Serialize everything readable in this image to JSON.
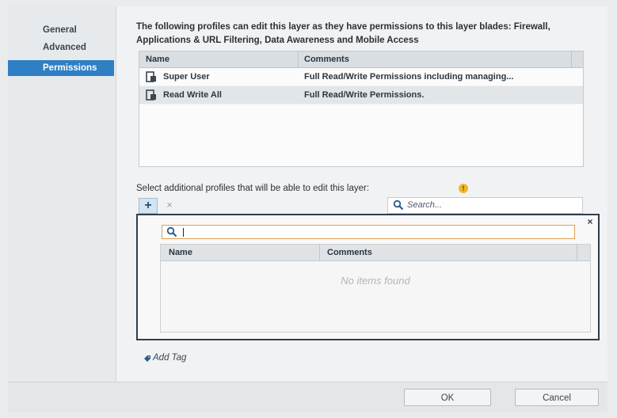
{
  "sidebar": {
    "items": [
      {
        "label": "General"
      },
      {
        "label": "Advanced"
      },
      {
        "label": "Permissions",
        "active": true
      }
    ]
  },
  "main": {
    "description": "The following profiles can edit this layer as they have permissions to this layer blades: Firewall, Applications & URL Filtering, Data Awareness and Mobile Access",
    "profiles_table": {
      "columns": [
        "Name",
        "Comments"
      ],
      "rows": [
        {
          "name": "Super User",
          "comments": "Full Read/Write Permissions including managing..."
        },
        {
          "name": "Read Write All",
          "comments": "Full Read/Write Permissions."
        }
      ]
    },
    "select_label": "Select additional profiles that will be able to edit this layer:",
    "toolbar": {
      "add_label": "+",
      "remove_label": "×",
      "search_placeholder": "Search..."
    },
    "popup": {
      "close_label": "×",
      "search_value": "",
      "columns": [
        "Name",
        "Comments"
      ],
      "empty_message": "No items found"
    },
    "add_tag_label": "Add Tag"
  },
  "footer": {
    "ok_label": "OK",
    "cancel_label": "Cancel"
  },
  "colors": {
    "accent": "#2f7fc4",
    "hint": "#f1b824",
    "popup_border": "#2d3e4f"
  },
  "icons": {
    "profile": "profile-icon",
    "search": "search-icon",
    "tag": "tag-icon",
    "hint": "hint-icon"
  }
}
